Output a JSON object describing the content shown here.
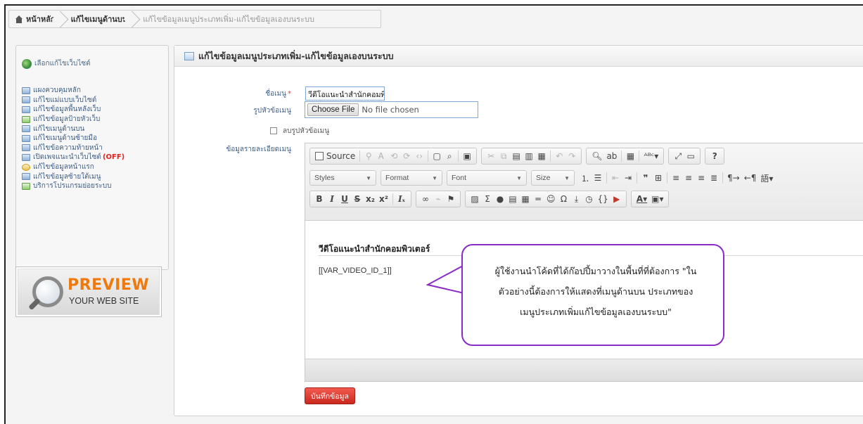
{
  "breadcrumb": {
    "home": "หน้าหลัก",
    "level1": "แก้ไขเมนูด้านบน",
    "current": "แก้ไขข้อมูลเมนูประเภทเพิ่ม-แก้ไขข้อมูลเองบนระบบ"
  },
  "sidebar": {
    "site_select": "เลือกแก้ไขเว็บไซต์",
    "items": [
      {
        "label": "แผงควบคุมหลัก",
        "badge": ""
      },
      {
        "label": "แก้ไขแม่แบบเว็บไซต์",
        "badge": ""
      },
      {
        "label": "แก้ไขข้อมูลพื้นหลังเว็บ",
        "badge": ""
      },
      {
        "label": "แก้ไขข้อมูลป้ายหัวเว็บ",
        "badge": ""
      },
      {
        "label": "แก้ไขเมนูด้านบน",
        "badge": ""
      },
      {
        "label": "แก้ไขเมนูด้านซ้ายมือ",
        "badge": ""
      },
      {
        "label": "แก้ไขข้อความท้ายหน้า",
        "badge": ""
      },
      {
        "label": "เปิดเพจแนะนำเว็บไซต์",
        "badge": "(OFF)"
      },
      {
        "label": "แก้ไขข้อมูลหน้าแรก",
        "badge": ""
      },
      {
        "label": "แก้ไขข้อมูลซ้ายใต้เมนู",
        "badge": ""
      },
      {
        "label": "บริการโปรแกรมย่อยระบบ",
        "badge": ""
      }
    ],
    "preview": {
      "title": "PREVIEW",
      "subtitle": "YOUR WEB SITE"
    }
  },
  "panel": {
    "title": "แก้ไขข้อมูลเมนูประเภทเพิ่ม-แก้ไขข้อมูลเองบนระบบ",
    "form": {
      "menu_name_label": "ชื่อเมนู",
      "menu_name_required": "*",
      "menu_name_value": "วีดีโอแนะนำสำนักคอมพิวเตอร์",
      "header_image_label": "รูปหัวข้อเมนู",
      "choose_file": "Choose File",
      "no_file": "No file chosen",
      "delete_image_label": "ลบรูปหัวข้อเมนู",
      "detail_label": "ข้อมูลรายละเอียดเมนู"
    },
    "toolbar": {
      "source": "Source",
      "styles": "Styles",
      "format": "Format",
      "font": "Font",
      "size": "Size"
    },
    "editor_content": {
      "title": "วีดีโอแนะนำสำนักคอมพิวเตอร์",
      "body": "[[VAR_VIDEO_ID_1]]"
    },
    "save_button": "บันทึกข้อมูล"
  },
  "callout": {
    "line1": "ผู้ใช้งานนำโค้ดที่ได้ก๊อปปี้มาวางในพื้นที่ที่ต้องการ \"ใน",
    "line2": "ตัวอย่างนี้ต้องการให้แสดงที่เมนูด้านบน ประเภทของ",
    "line3": "เมนูประเภทเพิ่มแก้ไขข้อมูลเองบนระบบ\""
  },
  "colors": {
    "save_button": "#d9342a",
    "callout_border": "#8a2bc7",
    "link_text": "#3e5f86",
    "preview_orange": "#f0790c",
    "off_badge": "#e32222"
  }
}
